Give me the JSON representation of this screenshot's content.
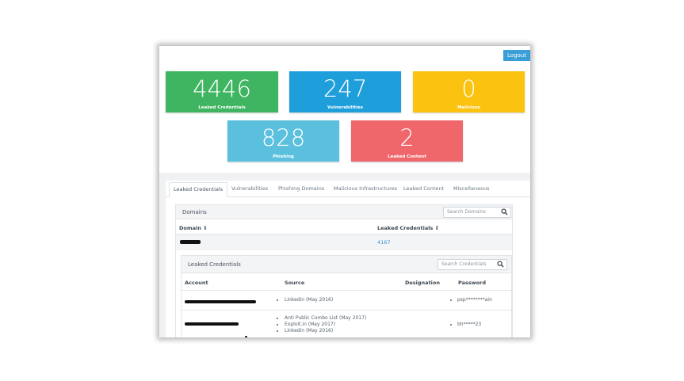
{
  "header": {
    "logout_label": "Logout"
  },
  "stats": [
    {
      "value": "4446",
      "label": "Leaked Credentials",
      "color": "#3fb561"
    },
    {
      "value": "247",
      "label": "Vulnerabilities",
      "color": "#1e9fdc"
    },
    {
      "value": "0",
      "label": "Malicious",
      "color": "#fbc210"
    },
    {
      "value": "828",
      "label": "Phishing",
      "color": "#5bc0de"
    },
    {
      "value": "2",
      "label": "Leaked Content",
      "color": "#f0676b"
    }
  ],
  "tabs": [
    "Leaked Credentials",
    "Vulnerabilities",
    "Phishing Domains",
    "Malicious Infrastructures",
    "Leaked Content",
    "Miscellaneous"
  ],
  "domains": {
    "title": "Domains",
    "search_placeholder": "Search Domains",
    "col_domain": "Domain ⇕",
    "col_leaked": "Leaked Credentials ⇕",
    "rows": [
      {
        "leaked": "4167"
      }
    ]
  },
  "credentials": {
    "title": "Leaked Credentials",
    "search_placeholder": "Search Credentials",
    "columns": {
      "account": "Account",
      "source": "Source",
      "designation": "Designation",
      "password": "Password"
    },
    "rows": [
      {
        "sources": [
          "Linkedin (May 2016)"
        ],
        "password": "psp********ain"
      },
      {
        "sources": [
          "Anti Public Combo List (May 2017)",
          "Exploit.in (May 2017)",
          "Linkedin (May 2016)"
        ],
        "password": "bh*****23"
      }
    ]
  }
}
